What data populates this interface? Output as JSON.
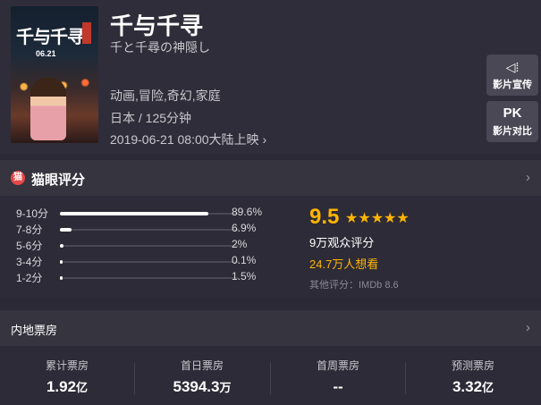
{
  "movie": {
    "title": "千与千寻",
    "original_title": "千と千尋の神隠し",
    "genres": "动画,冒险,奇幻,家庭",
    "country_duration": "日本 / 125分钟",
    "release": "2019-06-21 08:00大陆上映",
    "release_chevron": "›"
  },
  "poster": {
    "title": "千与千寻",
    "date": "06.21"
  },
  "side_buttons": {
    "promo_icon": "◁⁞",
    "promo_label": "影片宣传",
    "pk_text": "PK",
    "pk_label": "影片对比"
  },
  "rating": {
    "header_icon": "🐱",
    "header_title": "猫眼评分",
    "chevron": "›",
    "distribution": [
      {
        "label": "9-10分",
        "percent": "89.6%",
        "fraction": 0.896
      },
      {
        "label": "7-8分",
        "percent": "6.9%",
        "fraction": 0.069
      },
      {
        "label": "5-6分",
        "percent": "2%",
        "fraction": 0.02
      },
      {
        "label": "3-4分",
        "percent": "0.1%",
        "fraction": 0.001
      },
      {
        "label": "1-2分",
        "percent": "1.5%",
        "fraction": 0.015
      }
    ],
    "score": "9.5",
    "stars": "★★★★★",
    "audience": "9万观众评分",
    "want": "24.7万人想看",
    "other": "其他评分：IMDb 8.6"
  },
  "box_office": {
    "title": "内地票房",
    "chevron": "›",
    "stats": [
      {
        "label": "累计票房",
        "value": "1.92",
        "unit": "亿"
      },
      {
        "label": "首日票房",
        "value": "5394.3",
        "unit": "万"
      },
      {
        "label": "首周票房",
        "value": "--",
        "unit": ""
      },
      {
        "label": "预测票房",
        "value": "3.32",
        "unit": "亿"
      }
    ]
  },
  "colors": {
    "accent": "#ffb400",
    "brand_red": "#e54847",
    "background": "#2a2935"
  }
}
